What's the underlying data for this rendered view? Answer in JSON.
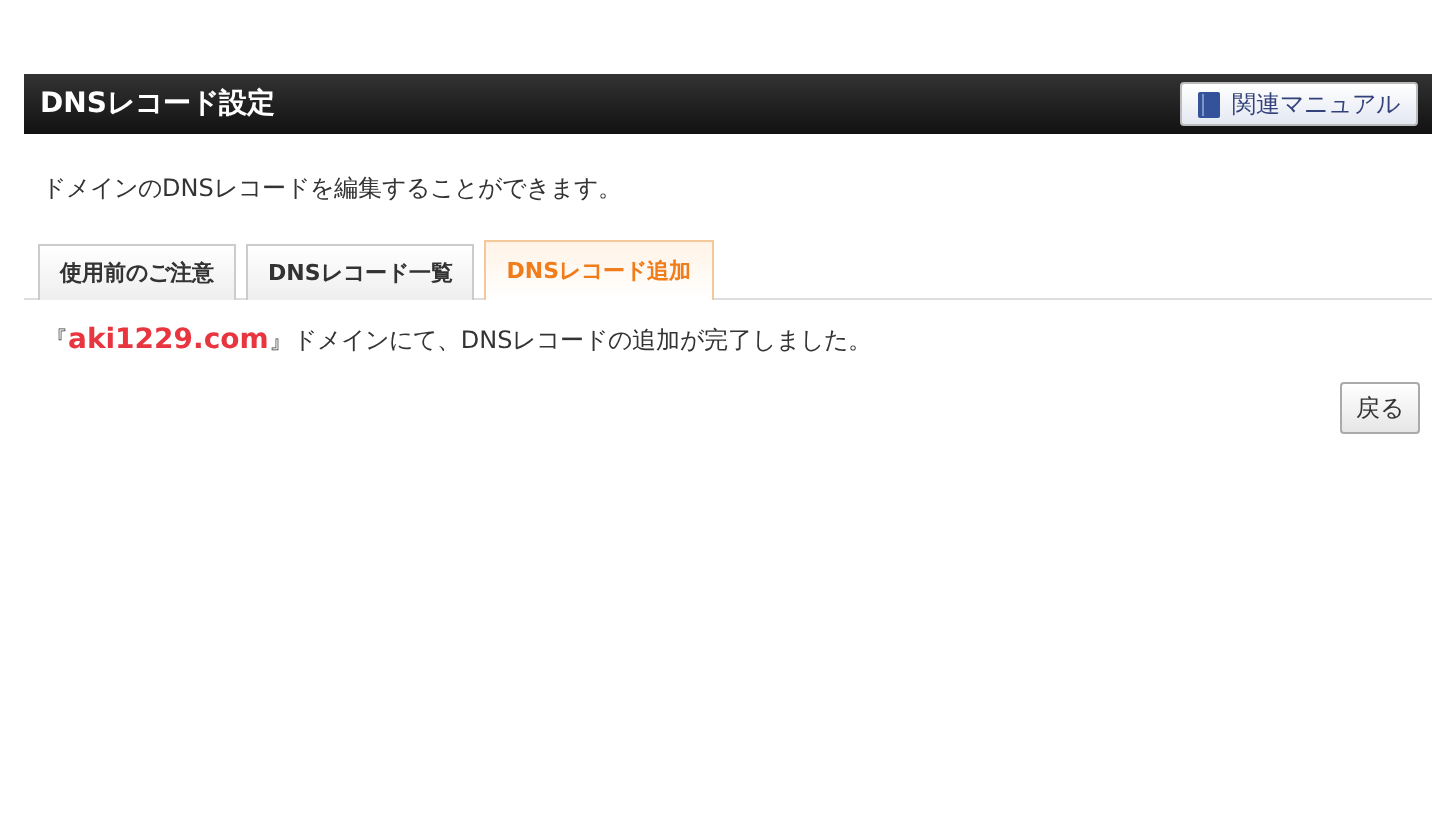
{
  "header": {
    "title": "DNSレコード設定",
    "manual_button": "関連マニュアル"
  },
  "description": "ドメインのDNSレコードを編集することができます。",
  "tabs": [
    {
      "label": "使用前のご注意",
      "selected": false
    },
    {
      "label": "DNSレコード一覧",
      "selected": false
    },
    {
      "label": "DNSレコード追加",
      "selected": true
    }
  ],
  "message": "『**aki1229.com**』ドメインにて、DNSレコードの追加が完了しました。",
  "back_button": "戻る"
}
